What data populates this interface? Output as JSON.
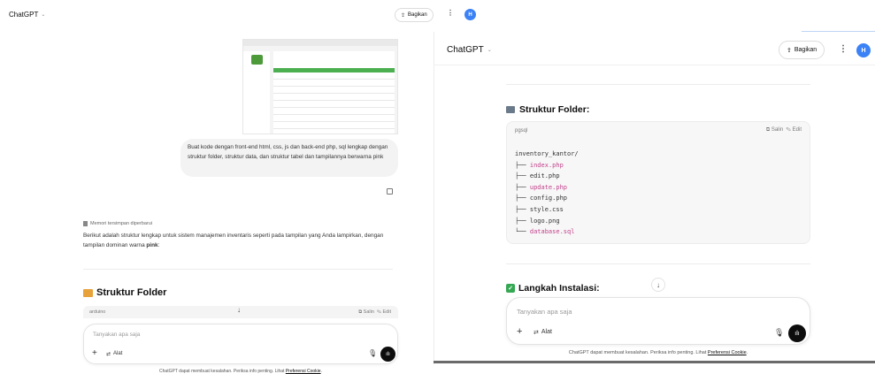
{
  "left": {
    "app_title": "ChatGPT",
    "share_label": "Bagikan",
    "avatar_initial": "H",
    "user_message": "Buat kode dengan front-end html, css, js dan back-end php, sql lengkap dengan struktur folder, struktur data, dan struktur tabel dan tampilannya berwarna pink",
    "memory_note": "Memori tersimpan diperbarui",
    "answer_text_1": "Berikut adalah struktur lengkap untuk sistem manajemen inventaris seperti pada tampilan yang Anda lampirkan, dengan tampilan dominan warna ",
    "answer_bold": "pink",
    "answer_text_2": ":",
    "heading": "Struktur Folder",
    "code_lang": "arduino",
    "copy_label": "Salin",
    "edit_label": "Edit",
    "input_placeholder": "Tanyakan apa saja",
    "tools_label": "Alat",
    "footer_text": "ChatGPT dapat membuat kesalahan. Periksa info penting. Lihat ",
    "footer_link": "Preferensi Cookie",
    "footer_end": "."
  },
  "right": {
    "app_title": "ChatGPT",
    "share_label": "Bagikan",
    "avatar_initial": "H",
    "heading": "Struktur Folder:",
    "code_lang": "pgsql",
    "copy_label": "Salin",
    "edit_label": "Edit",
    "code_lines": [
      {
        "prefix": "inventory_kantor/",
        "name": "",
        "ext": ""
      },
      {
        "prefix": "├── ",
        "name": "index",
        "ext": ".php",
        "hl": true
      },
      {
        "prefix": "├── ",
        "name": "edit",
        "ext": ".php",
        "hl": false
      },
      {
        "prefix": "├── ",
        "name": "update",
        "ext": ".php",
        "hl": true
      },
      {
        "prefix": "├── ",
        "name": "config",
        "ext": ".php",
        "hl": false
      },
      {
        "prefix": "├── ",
        "name": "style",
        "ext": ".css",
        "hl": false
      },
      {
        "prefix": "├── ",
        "name": "logo",
        "ext": ".png",
        "hl": false
      },
      {
        "prefix": "└── ",
        "name": "database",
        "ext": ".sql",
        "hl": true
      }
    ],
    "heading2": "Langkah Instalasi:",
    "input_placeholder": "Tanyakan apa saja",
    "tools_label": "Alat",
    "footer_text": "ChatGPT dapat membuat kesalahan. Periksa info penting. Lihat ",
    "footer_link": "Preferensi Cookie",
    "footer_end": "."
  },
  "icons": {
    "chevron": "chevron-down-icon",
    "share": "share-icon",
    "kebab": "more-options-icon",
    "copy": "copy-icon",
    "memory": "memory-icon",
    "folder": "folder-emoji-icon",
    "scroll_down": "arrow-down-icon",
    "plus": "plus-icon",
    "tools": "sliders-icon",
    "mic": "microphone-icon",
    "voice": "voice-mode-icon",
    "check": "check-emoji-icon"
  },
  "colors": {
    "accent_pink": "#c2418b",
    "avatar_blue": "#3b82f6",
    "voice_button": "#0d0d0d"
  }
}
